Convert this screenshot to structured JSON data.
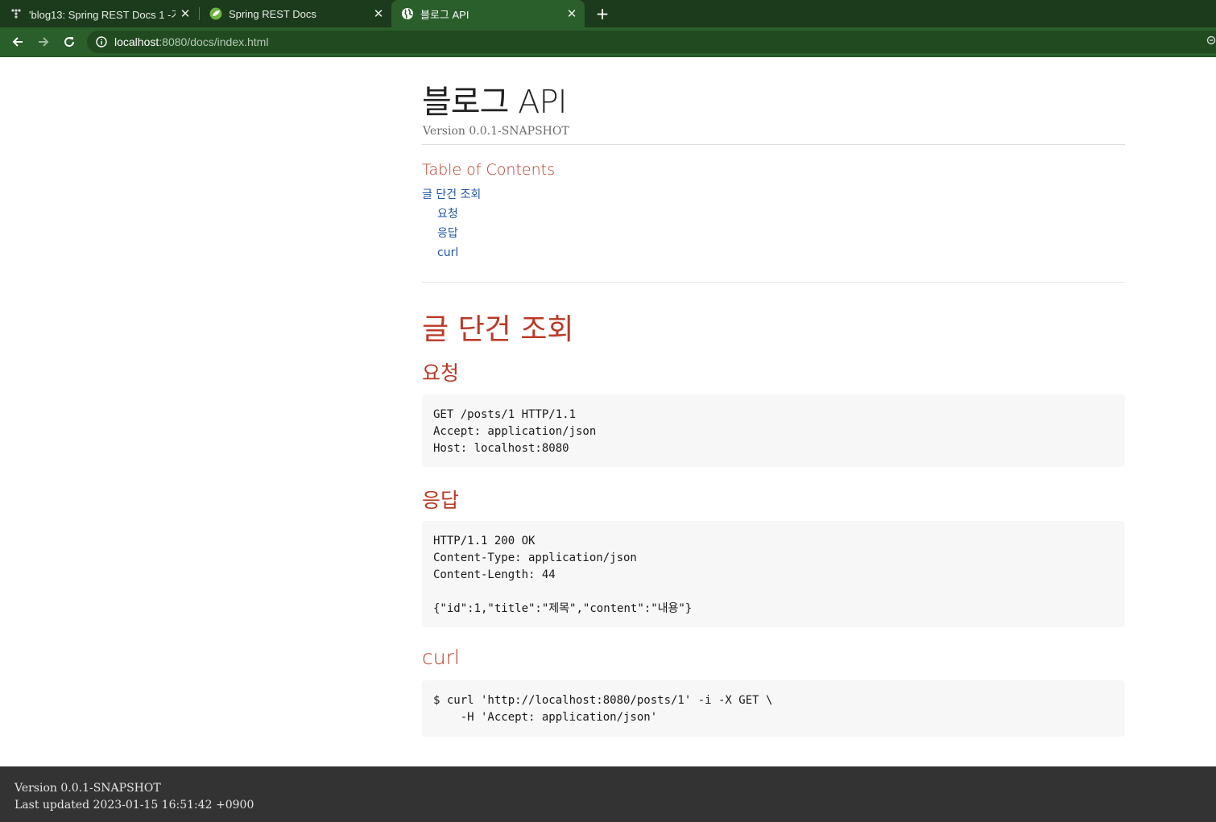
{
  "browser": {
    "tabs": [
      {
        "title": "'blog13: Spring REST Docs 1 -기",
        "icon": "tistory-icon",
        "active": false
      },
      {
        "title": "Spring REST Docs",
        "icon": "spring-icon",
        "active": false
      },
      {
        "title": "블로그 API",
        "icon": "globe-icon",
        "active": true
      }
    ],
    "new_tab_label": "+",
    "close_label": "✕",
    "url_host": "localhost",
    "url_rest": ":8080/docs/index.html",
    "colors": {
      "tabbar": "#1c3a1c",
      "toolbar": "#2a5e2a"
    }
  },
  "doc": {
    "title": "블로그 API",
    "version": "Version 0.0.1-SNAPSHOT",
    "toc": {
      "title": "Table of Contents",
      "items": [
        {
          "label": "글 단건 조회",
          "level": 1
        },
        {
          "label": "요청",
          "level": 2
        },
        {
          "label": "응답",
          "level": 2
        },
        {
          "label": "curl",
          "level": 2
        }
      ]
    },
    "section": {
      "title": "글 단건 조회",
      "request": {
        "title": "요청",
        "code": "GET /posts/1 HTTP/1.1\nAccept: application/json\nHost: localhost:8080"
      },
      "response": {
        "title": "응답",
        "code": "HTTP/1.1 200 OK\nContent-Type: application/json\nContent-Length: 44\n\n{\"id\":1,\"title\":\"제목\",\"content\":\"내용\"}"
      },
      "curl": {
        "title": "curl",
        "code": "$ curl 'http://localhost:8080/posts/1' -i -X GET \\\n    -H 'Accept: application/json'"
      }
    },
    "colors": {
      "heading": "#ba3925",
      "link": "#2156a5"
    }
  },
  "footer": {
    "version": "Version 0.0.1-SNAPSHOT",
    "last_updated": "Last updated 2023-01-15 16:51:42 +0900"
  }
}
